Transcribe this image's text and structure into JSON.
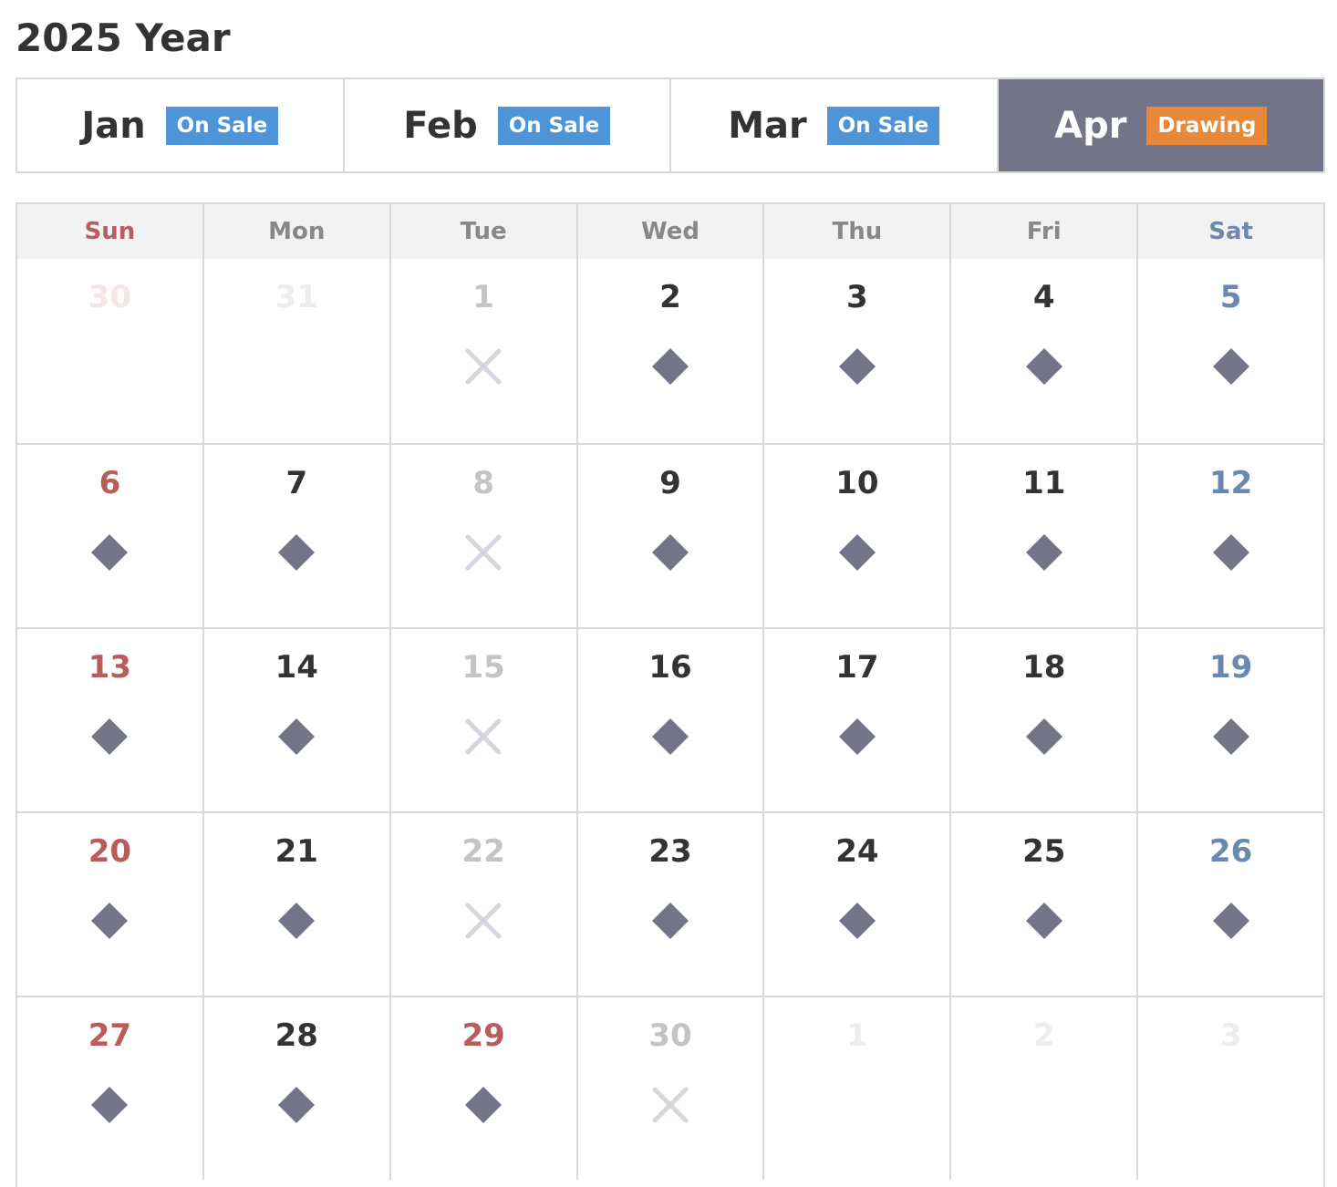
{
  "title": "2025 Year",
  "months": [
    {
      "name": "Jan",
      "badge": "On Sale",
      "badge_color": "#4d95d8",
      "active": false
    },
    {
      "name": "Feb",
      "badge": "On Sale",
      "badge_color": "#4d95d8",
      "active": false
    },
    {
      "name": "Mar",
      "badge": "On Sale",
      "badge_color": "#4d95d8",
      "active": false
    },
    {
      "name": "Apr",
      "badge": "Drawing",
      "badge_color": "#e8893a",
      "active": true
    }
  ],
  "colors": {
    "active_tab": "#747488",
    "diamond": "#747488",
    "cross": "#d6d6de",
    "sunday": "#b85c5c",
    "saturday": "#6a88b0"
  },
  "weekdays": [
    "Sun",
    "Mon",
    "Tue",
    "Wed",
    "Thu",
    "Fri",
    "Sat"
  ],
  "weeks": [
    [
      {
        "day": "30",
        "status": "other",
        "mark": "none"
      },
      {
        "day": "31",
        "status": "other",
        "mark": "none"
      },
      {
        "day": "1",
        "status": "closed",
        "mark": "cross-icon"
      },
      {
        "day": "2",
        "status": "open",
        "mark": "diamond-icon"
      },
      {
        "day": "3",
        "status": "open",
        "mark": "diamond-icon"
      },
      {
        "day": "4",
        "status": "open",
        "mark": "diamond-icon"
      },
      {
        "day": "5",
        "status": "open",
        "mark": "diamond-icon"
      }
    ],
    [
      {
        "day": "6",
        "status": "open",
        "mark": "diamond-icon"
      },
      {
        "day": "7",
        "status": "open",
        "mark": "diamond-icon"
      },
      {
        "day": "8",
        "status": "closed",
        "mark": "cross-icon"
      },
      {
        "day": "9",
        "status": "open",
        "mark": "diamond-icon"
      },
      {
        "day": "10",
        "status": "open",
        "mark": "diamond-icon"
      },
      {
        "day": "11",
        "status": "open",
        "mark": "diamond-icon"
      },
      {
        "day": "12",
        "status": "open",
        "mark": "diamond-icon"
      }
    ],
    [
      {
        "day": "13",
        "status": "open",
        "mark": "diamond-icon"
      },
      {
        "day": "14",
        "status": "open",
        "mark": "diamond-icon"
      },
      {
        "day": "15",
        "status": "closed",
        "mark": "cross-icon"
      },
      {
        "day": "16",
        "status": "open",
        "mark": "diamond-icon"
      },
      {
        "day": "17",
        "status": "open",
        "mark": "diamond-icon"
      },
      {
        "day": "18",
        "status": "open",
        "mark": "diamond-icon"
      },
      {
        "day": "19",
        "status": "open",
        "mark": "diamond-icon"
      }
    ],
    [
      {
        "day": "20",
        "status": "open",
        "mark": "diamond-icon"
      },
      {
        "day": "21",
        "status": "open",
        "mark": "diamond-icon"
      },
      {
        "day": "22",
        "status": "closed",
        "mark": "cross-icon"
      },
      {
        "day": "23",
        "status": "open",
        "mark": "diamond-icon"
      },
      {
        "day": "24",
        "status": "open",
        "mark": "diamond-icon"
      },
      {
        "day": "25",
        "status": "open",
        "mark": "diamond-icon"
      },
      {
        "day": "26",
        "status": "open",
        "mark": "diamond-icon"
      }
    ],
    [
      {
        "day": "27",
        "status": "open",
        "mark": "diamond-icon"
      },
      {
        "day": "28",
        "status": "open",
        "mark": "diamond-icon"
      },
      {
        "day": "29",
        "status": "holiday",
        "mark": "diamond-icon"
      },
      {
        "day": "30",
        "status": "closed",
        "mark": "cross-icon"
      },
      {
        "day": "1",
        "status": "other",
        "mark": "none"
      },
      {
        "day": "2",
        "status": "other",
        "mark": "none"
      },
      {
        "day": "3",
        "status": "other",
        "mark": "none"
      }
    ]
  ]
}
